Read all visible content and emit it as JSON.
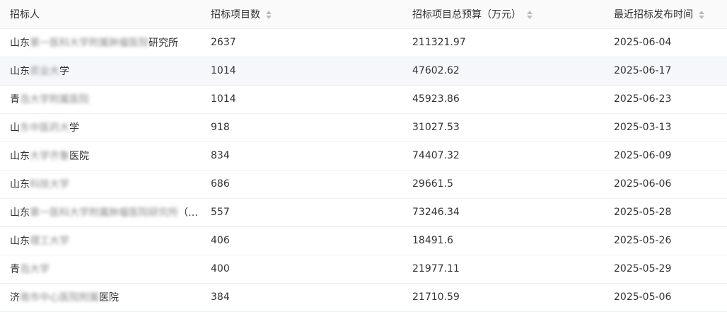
{
  "columns": [
    {
      "label": "招标人",
      "sortable": false
    },
    {
      "label": "招标项目数",
      "sortable": true
    },
    {
      "label": "招标项目总预算（万元）",
      "sortable": true
    },
    {
      "label": "最近招标发布时间",
      "sortable": true
    }
  ],
  "rows": [
    {
      "name_head": "山东",
      "name_blur": "第一医科大学附属肿瘤医院",
      "name_tail": "研究所",
      "count": "2637",
      "budget": "211321.97",
      "date": "2025-06-04"
    },
    {
      "name_head": "山东",
      "name_blur": "农业大",
      "name_tail": "学",
      "count": "1014",
      "budget": "47602.62",
      "date": "2025-06-17"
    },
    {
      "name_head": "青",
      "name_blur": "岛大学附属医院",
      "name_tail": "",
      "count": "1014",
      "budget": "45923.86",
      "date": "2025-06-23"
    },
    {
      "name_head": "山",
      "name_blur": "东中医药大",
      "name_tail": "学",
      "count": "918",
      "budget": "31027.53",
      "date": "2025-03-13"
    },
    {
      "name_head": "山东",
      "name_blur": "大学齐鲁",
      "name_tail": "医院",
      "count": "834",
      "budget": "74407.32",
      "date": "2025-06-09"
    },
    {
      "name_head": "山东",
      "name_blur": "科技大学",
      "name_tail": "",
      "count": "686",
      "budget": "29661.5",
      "date": "2025-06-06"
    },
    {
      "name_head": "山东",
      "name_blur": "第一医科大学附属肿瘤医院研究所",
      "name_tail": "（山…",
      "count": "557",
      "budget": "73246.34",
      "date": "2025-05-28"
    },
    {
      "name_head": "山东",
      "name_blur": "理工大学",
      "name_tail": "",
      "count": "406",
      "budget": "18491.6",
      "date": "2025-05-26"
    },
    {
      "name_head": "青",
      "name_blur": "岛大学",
      "name_tail": "",
      "count": "400",
      "budget": "21977.11",
      "date": "2025-05-29"
    },
    {
      "name_head": "济",
      "name_blur": "南市中心医院附属",
      "name_tail": "医院",
      "count": "384",
      "budget": "21710.59",
      "date": "2025-05-06"
    }
  ],
  "highlighted_row_index": 1,
  "colors": {
    "header_bg": "#fafafa",
    "highlight_bg": "#f5f7fa",
    "border": "#ebeef5",
    "sort_arrow": "#b8bcc4"
  }
}
